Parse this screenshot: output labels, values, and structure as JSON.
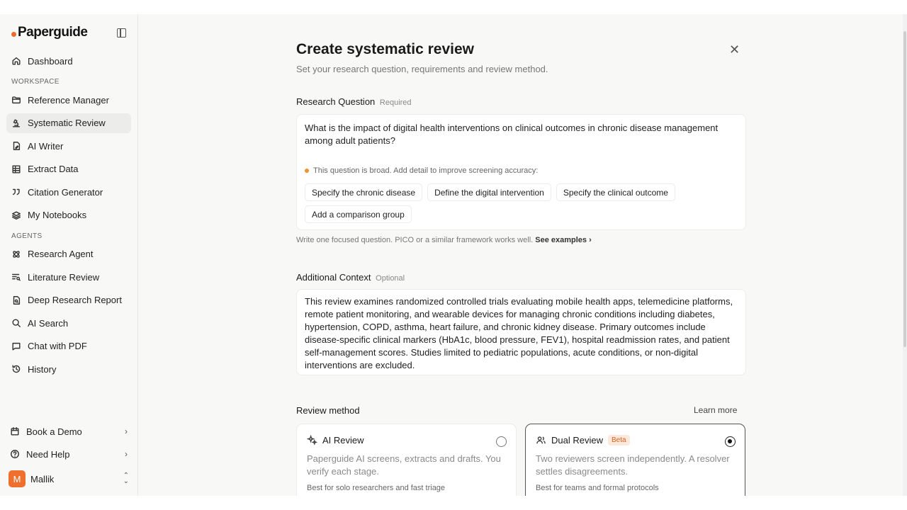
{
  "brand": {
    "name": "Paperguide"
  },
  "sidebar": {
    "top_items": [
      {
        "label": "Dashboard",
        "icon": "home-icon"
      }
    ],
    "workspace_label": "WORKSPACE",
    "workspace_items": [
      {
        "label": "Reference Manager",
        "icon": "folder-icon"
      },
      {
        "label": "Systematic Review",
        "icon": "microscope-icon"
      },
      {
        "label": "AI Writer",
        "icon": "document-pen-icon"
      },
      {
        "label": "Extract Data",
        "icon": "table-icon"
      },
      {
        "label": "Citation Generator",
        "icon": "quote-icon"
      },
      {
        "label": "My Notebooks",
        "icon": "layers-icon"
      }
    ],
    "agents_label": "AGENTS",
    "agent_items": [
      {
        "label": "Research Agent",
        "icon": "atom-icon"
      },
      {
        "label": "Literature Review",
        "icon": "list-search-icon"
      },
      {
        "label": "Deep Research Report",
        "icon": "report-icon"
      },
      {
        "label": "AI Search",
        "icon": "search-icon"
      },
      {
        "label": "Chat with PDF",
        "icon": "chat-icon"
      },
      {
        "label": "History",
        "icon": "history-icon"
      }
    ],
    "book_demo": "Book a Demo",
    "need_help": "Need Help",
    "user": {
      "initial": "M",
      "name": "Mallik"
    }
  },
  "dialog": {
    "title": "Create systematic review",
    "subtitle": "Set your research question, requirements and review method.",
    "research_question": {
      "label": "Research Question",
      "tag": "Required",
      "value": "What is the impact of digital health interventions on clinical outcomes in chronic disease management among adult patients?",
      "warning": "This question is broad. Add detail to improve screening accuracy:",
      "suggestions": [
        "Specify the chronic disease",
        "Define the digital intervention",
        "Specify the clinical outcome",
        "Add a comparison group"
      ],
      "hint": "Write one focused question. PICO or a similar framework works well.",
      "hint_link": "See examples"
    },
    "additional_context": {
      "label": "Additional Context",
      "tag": "Optional",
      "value": "This review examines randomized controlled trials evaluating mobile health apps, telemedicine platforms, remote patient monitoring, and wearable devices for managing chronic conditions including diabetes, hypertension, COPD, asthma, heart failure, and chronic kidney disease. Primary outcomes include disease-specific clinical markers (HbA1c, blood pressure, FEV1), hospital readmission rates, and patient self-management scores. Studies limited to pediatric populations, acute conditions, or non-digital interventions are excluded."
    },
    "review_method": {
      "label": "Review method",
      "learn_more": "Learn more",
      "options": [
        {
          "name": "AI Review",
          "description": "Paperguide AI screens, extracts and drafts. You verify each stage.",
          "best_for": "Best for solo researchers and fast triage",
          "selected": false
        },
        {
          "name": "Dual Review",
          "badge": "Beta",
          "description": "Two reviewers screen independently. A resolver settles disagreements.",
          "best_for": "Best for teams and formal protocols",
          "selected": true
        }
      ]
    }
  },
  "colors": {
    "accent": "#ee6a2a",
    "warning": "#f2932d",
    "beta_text": "#d3621f"
  }
}
